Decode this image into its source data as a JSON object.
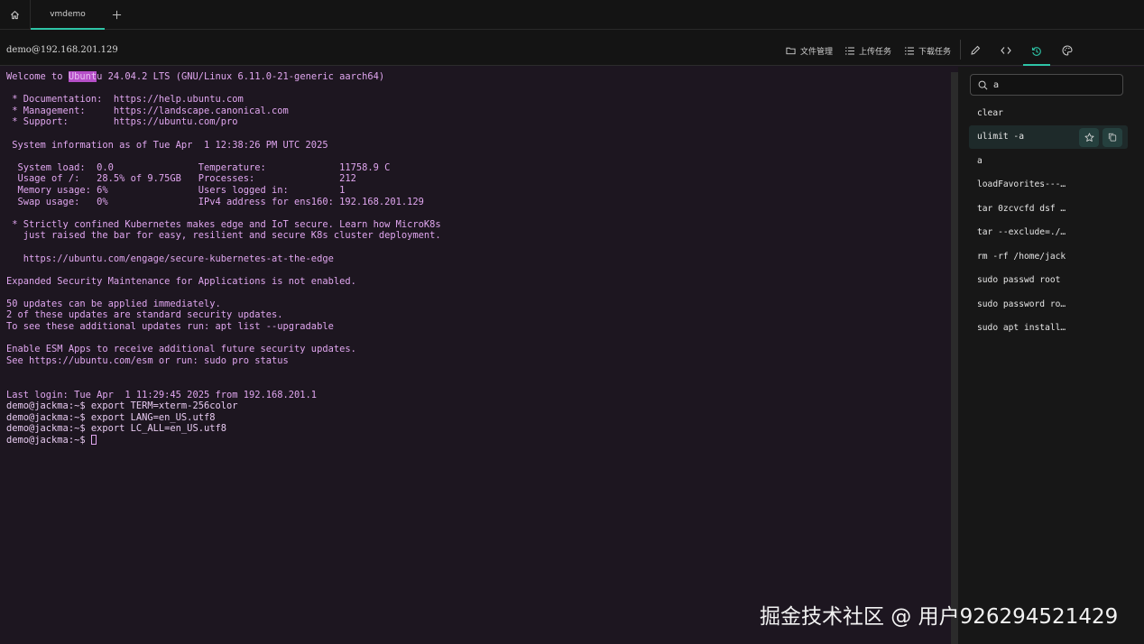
{
  "tabs": {
    "active_tab": "vmdemo",
    "home_icon": "home-icon",
    "add_icon": "plus-icon"
  },
  "header": {
    "host": "demo@192.168.201.129",
    "file_manager": "文件管理",
    "upload_tasks": "上传任务",
    "download_tasks": "下载任务",
    "icons": [
      "pencil-icon",
      "code-icon",
      "history-icon",
      "palette-icon"
    ]
  },
  "terminal": {
    "lines": [
      {
        "pre": "Welcome to ",
        "hl": "Ubunt",
        "post": "u 24.04.2 LTS (GNU/Linux 6.11.0-21-generic aarch64)"
      },
      {
        "text": ""
      },
      {
        "text": " * Documentation:  https://help.ubuntu.com"
      },
      {
        "text": " * Management:     https://landscape.canonical.com"
      },
      {
        "text": " * Support:        https://ubuntu.com/pro"
      },
      {
        "text": ""
      },
      {
        "text": " System information as of Tue Apr  1 12:38:26 PM UTC 2025"
      },
      {
        "text": ""
      },
      {
        "text": "  System load:  0.0               Temperature:             11758.9 C"
      },
      {
        "text": "  Usage of /:   28.5% of 9.75GB   Processes:               212"
      },
      {
        "text": "  Memory usage: 6%                Users logged in:         1"
      },
      {
        "text": "  Swap usage:   0%                IPv4 address for ens160: 192.168.201.129"
      },
      {
        "text": ""
      },
      {
        "text": " * Strictly confined Kubernetes makes edge and IoT secure. Learn how MicroK8s"
      },
      {
        "text": "   just raised the bar for easy, resilient and secure K8s cluster deployment."
      },
      {
        "text": ""
      },
      {
        "text": "   https://ubuntu.com/engage/secure-kubernetes-at-the-edge"
      },
      {
        "text": ""
      },
      {
        "text": "Expanded Security Maintenance for Applications is not enabled."
      },
      {
        "text": ""
      },
      {
        "text": "50 updates can be applied immediately."
      },
      {
        "text": "2 of these updates are standard security updates."
      },
      {
        "text": "To see these additional updates run: apt list --upgradable"
      },
      {
        "text": ""
      },
      {
        "text": "Enable ESM Apps to receive additional future security updates."
      },
      {
        "text": "See https://ubuntu.com/esm or run: sudo pro status"
      },
      {
        "text": ""
      },
      {
        "text": ""
      },
      {
        "text": "Last login: Tue Apr  1 11:29:45 2025 from 192.168.201.1"
      },
      {
        "text": "demo@jackma:~$ export TERM=xterm-256color",
        "prompt": true
      },
      {
        "text": "demo@jackma:~$ export LANG=en_US.utf8",
        "prompt": true
      },
      {
        "text": "demo@jackma:~$ export LC_ALL=en_US.utf8",
        "prompt": true
      },
      {
        "text": "demo@jackma:~$ ",
        "prompt": true,
        "cursor": true
      }
    ]
  },
  "history": {
    "search_value": "a",
    "items": [
      "clear",
      "ulimit -a",
      "a",
      "loadFavorites---…",
      "tar 0zcvcfd dsf …",
      "tar --exclude=./…",
      "rm -rf /home/jack",
      "sudo passwd root",
      "sudo password ro…",
      "sudo apt install…"
    ],
    "hover_index": 1,
    "action_icons": [
      "star-icon",
      "copy-icon"
    ]
  },
  "watermark": "掘金技术社区 @ 用户926294521429",
  "colors": {
    "accent": "#2ec4a6",
    "terminal_text": "#e0a6ef",
    "terminal_bg": "#1d1620",
    "highlight": "#b64fc8"
  }
}
